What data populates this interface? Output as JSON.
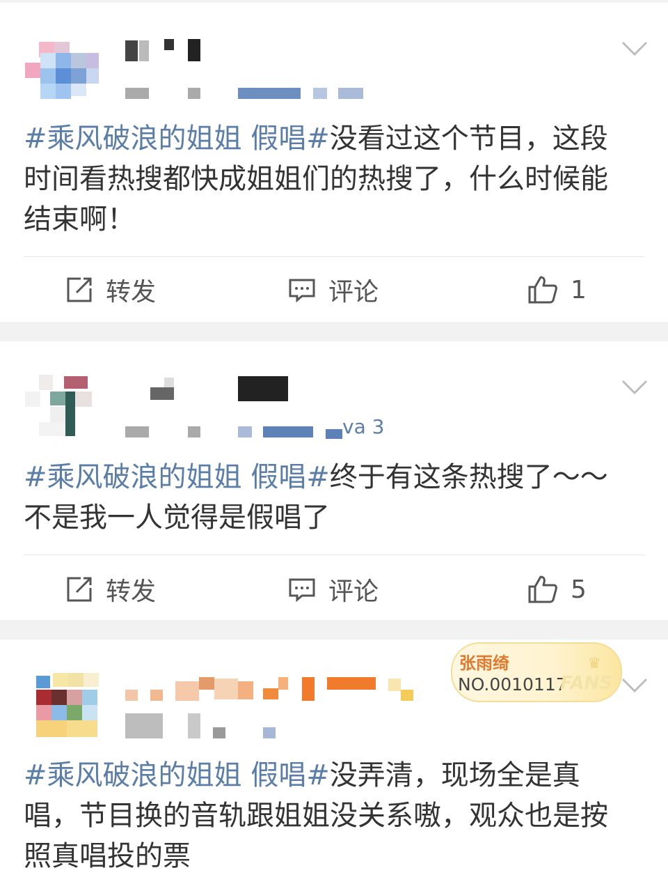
{
  "posts": [
    {
      "text_tag": "#乘风破浪的姐姐 假唱#",
      "text_body": "没看过这个节目，这段\n时间看热搜都快成姐姐们的热搜了，什么时候能\n结束啊！",
      "repost_label": "转发",
      "comment_label": "评论",
      "like_count": "1"
    },
    {
      "level_text": "va 3",
      "text_tag": "#乘风破浪的姐姐 假唱#",
      "text_body": "终于有这条热搜了～～\n不是我一人觉得是假唱了",
      "repost_label": "转发",
      "comment_label": "评论",
      "like_count": "5"
    },
    {
      "text_tag": "#乘风破浪的姐姐 假唱#",
      "text_body": "没弄清，现场全是真\n唱，节目换的音轨跟姐姐没关系嗷，观众也是按\n照真唱投的票"
    }
  ],
  "fan_badge": {
    "name": "张雨绮",
    "number": "NO.0010117",
    "fans_label": "FANS"
  },
  "icons": {
    "repost": "repost-icon",
    "comment": "comment-icon",
    "like": "thumbs-up-icon",
    "more": "chevron-down-icon"
  },
  "colors": {
    "topic": "#5b7ea8",
    "text": "#333333",
    "action": "#555555",
    "background": "#f2f2f2"
  }
}
